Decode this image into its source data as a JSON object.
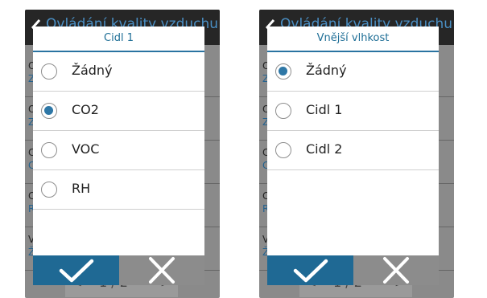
{
  "left": {
    "header_title": "Ovládání kvality vzduchu",
    "background_rows": [
      {
        "label": "Ov",
        "value": "Za"
      },
      {
        "label": "Ov",
        "value": "Za"
      },
      {
        "label": "Cid",
        "value": "CO"
      },
      {
        "label": "Cid",
        "value": "RH"
      },
      {
        "label": "Vn",
        "value": "Žá"
      }
    ],
    "pager": {
      "prev": "<",
      "page": "1 / 2",
      "next": ">"
    },
    "dialog": {
      "title": "Cidl 1",
      "options": [
        {
          "label": "Žádný",
          "selected": false
        },
        {
          "label": "CO2",
          "selected": true
        },
        {
          "label": "VOC",
          "selected": false
        },
        {
          "label": "RH",
          "selected": false
        }
      ]
    }
  },
  "right": {
    "header_title": "Ovládání kvality vzduchu",
    "background_rows": [
      {
        "label": "Ov",
        "value": "Za"
      },
      {
        "label": "Ov",
        "value": "Za"
      },
      {
        "label": "Cid",
        "value": "CO"
      },
      {
        "label": "Cid",
        "value": "RH"
      },
      {
        "label": "Vn",
        "value": "Žá"
      }
    ],
    "pager": {
      "prev": "<",
      "page": "1 / 2",
      "next": ">"
    },
    "dialog": {
      "title": "Vnější vlhkost",
      "options": [
        {
          "label": "Žádný",
          "selected": true
        },
        {
          "label": "Cidl 1",
          "selected": false
        },
        {
          "label": "Cidl 2",
          "selected": false
        }
      ]
    }
  },
  "icons": {
    "back": "chevron-left-icon",
    "confirm": "checkmark-icon",
    "cancel": "close-icon"
  },
  "colors": {
    "accent": "#2e77a6",
    "ok_button": "#1f6994",
    "cancel_button": "#8c8c8c",
    "header_bg": "#262626"
  }
}
